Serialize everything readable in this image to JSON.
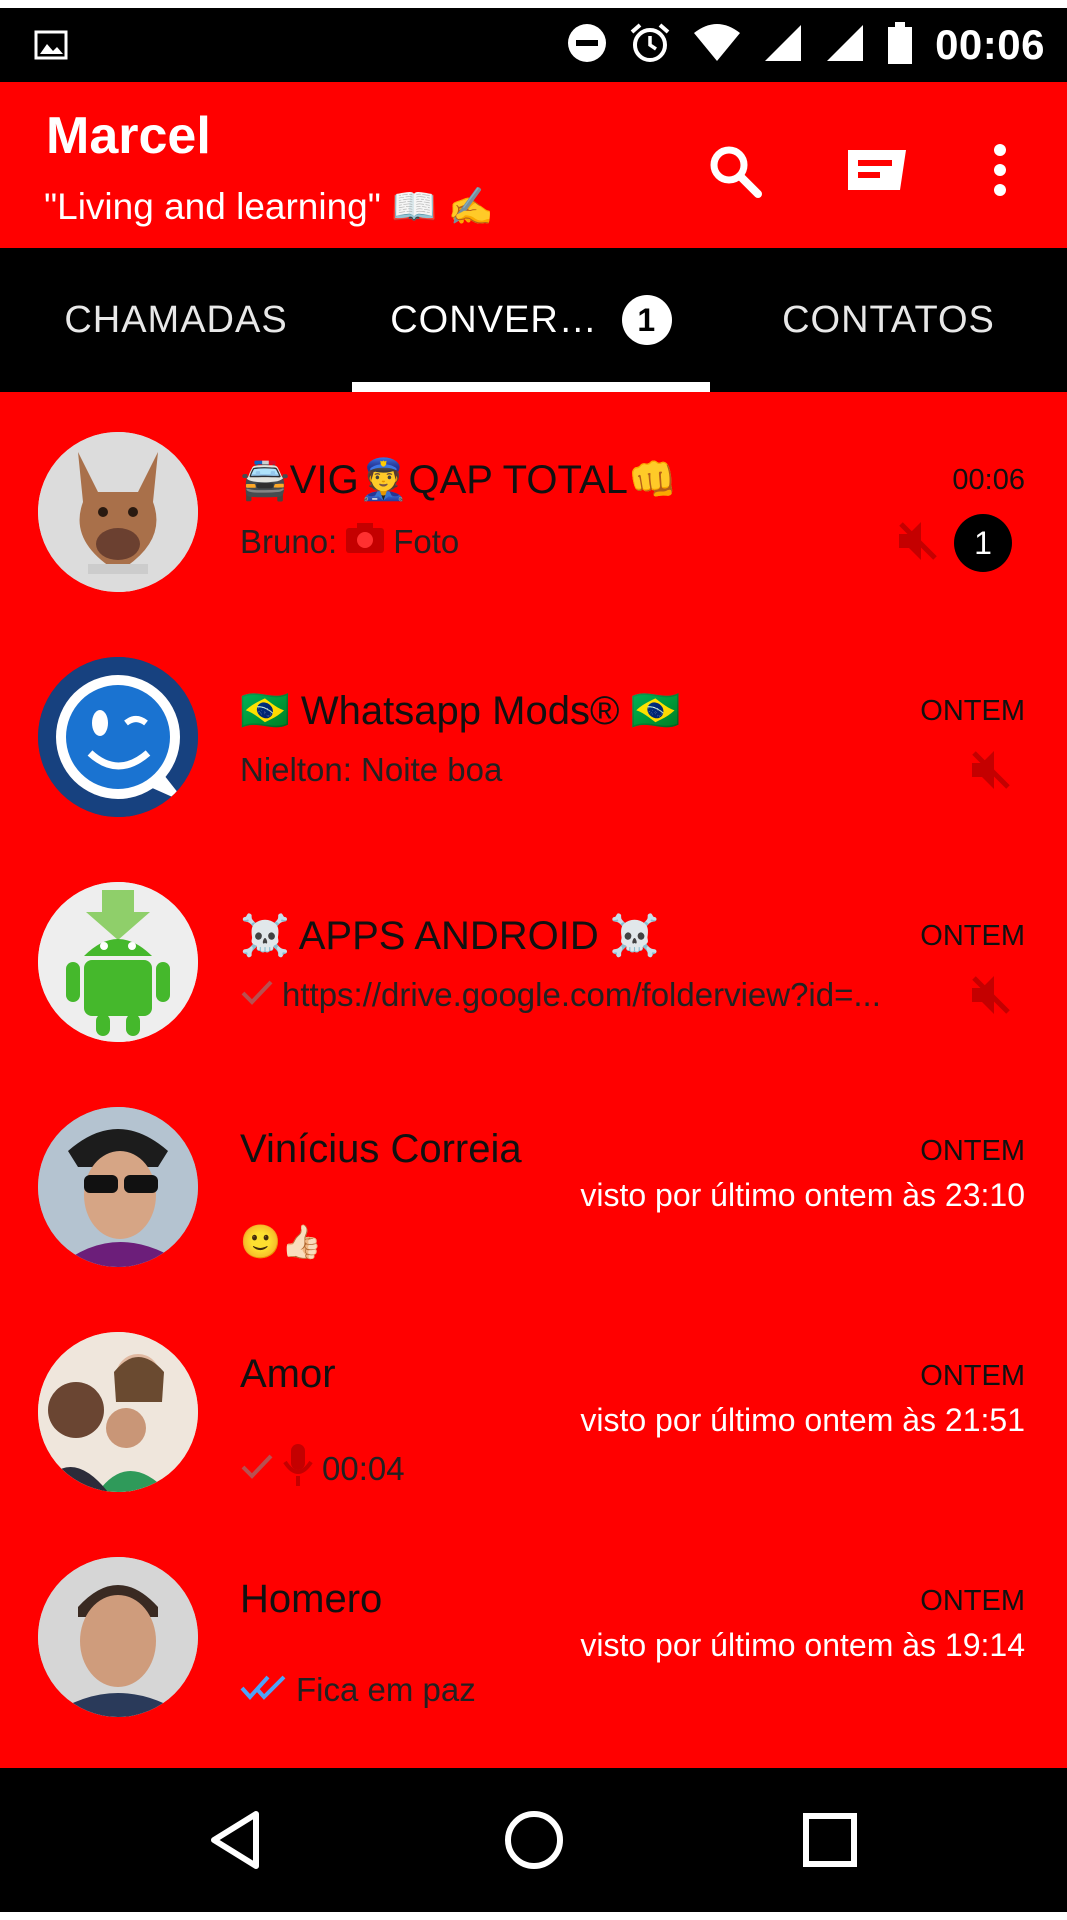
{
  "status_bar": {
    "time": "00:06",
    "icons": [
      "image-notification-icon",
      "do-not-disturb-icon",
      "alarm-icon",
      "wifi-icon",
      "signal-icon",
      "signal-icon",
      "battery-icon"
    ]
  },
  "app_bar": {
    "title": "Marcel",
    "status": "\"Living and learning\" 📖 ✍",
    "actions": [
      "search-icon",
      "new-chat-icon",
      "more-options-icon"
    ]
  },
  "tabs": [
    {
      "label": "CHAMADAS",
      "selected": false
    },
    {
      "label": "CONVER…",
      "selected": true,
      "badge": "1"
    },
    {
      "label": "CONTATOS",
      "selected": false
    }
  ],
  "chats": [
    {
      "name": "🚔VIG👮QAP TOTAL👊",
      "time": "00:06",
      "preview_sender": "Bruno:",
      "preview_text": "Foto",
      "preview_icon": "camera-icon",
      "muted": true,
      "unread": "1"
    },
    {
      "name": "🇧🇷 Whatsapp Mods® 🇧🇷",
      "time": "ONTEM",
      "preview_text": "Nielton: Noite boa",
      "muted": true
    },
    {
      "name": "☠️ APPS ANDROID ☠️",
      "time": "ONTEM",
      "preview_text": "https://drive.google.com/folderview?id=...",
      "preview_icon": "single-check-icon",
      "muted": true
    },
    {
      "name": "Vinícius Correia",
      "time": "ONTEM",
      "last_seen": "visto por último ontem às 23:10",
      "preview_text": "🙂👍🏻"
    },
    {
      "name": "Amor",
      "time": "ONTEM",
      "last_seen": "visto por último ontem às 21:51",
      "preview_text": "00:04",
      "preview_icon": "microphone-icon"
    },
    {
      "name": "Homero",
      "time": "ONTEM",
      "last_seen": "visto por último ontem às 19:14",
      "preview_text": "Fica em paz",
      "preview_icon": "double-check-icon"
    }
  ],
  "colors": {
    "accent": "#ff0000",
    "bar": "#000000",
    "read_tick": "#4fa3f7"
  },
  "nav_bar": [
    "back-icon",
    "home-icon",
    "recents-icon"
  ]
}
